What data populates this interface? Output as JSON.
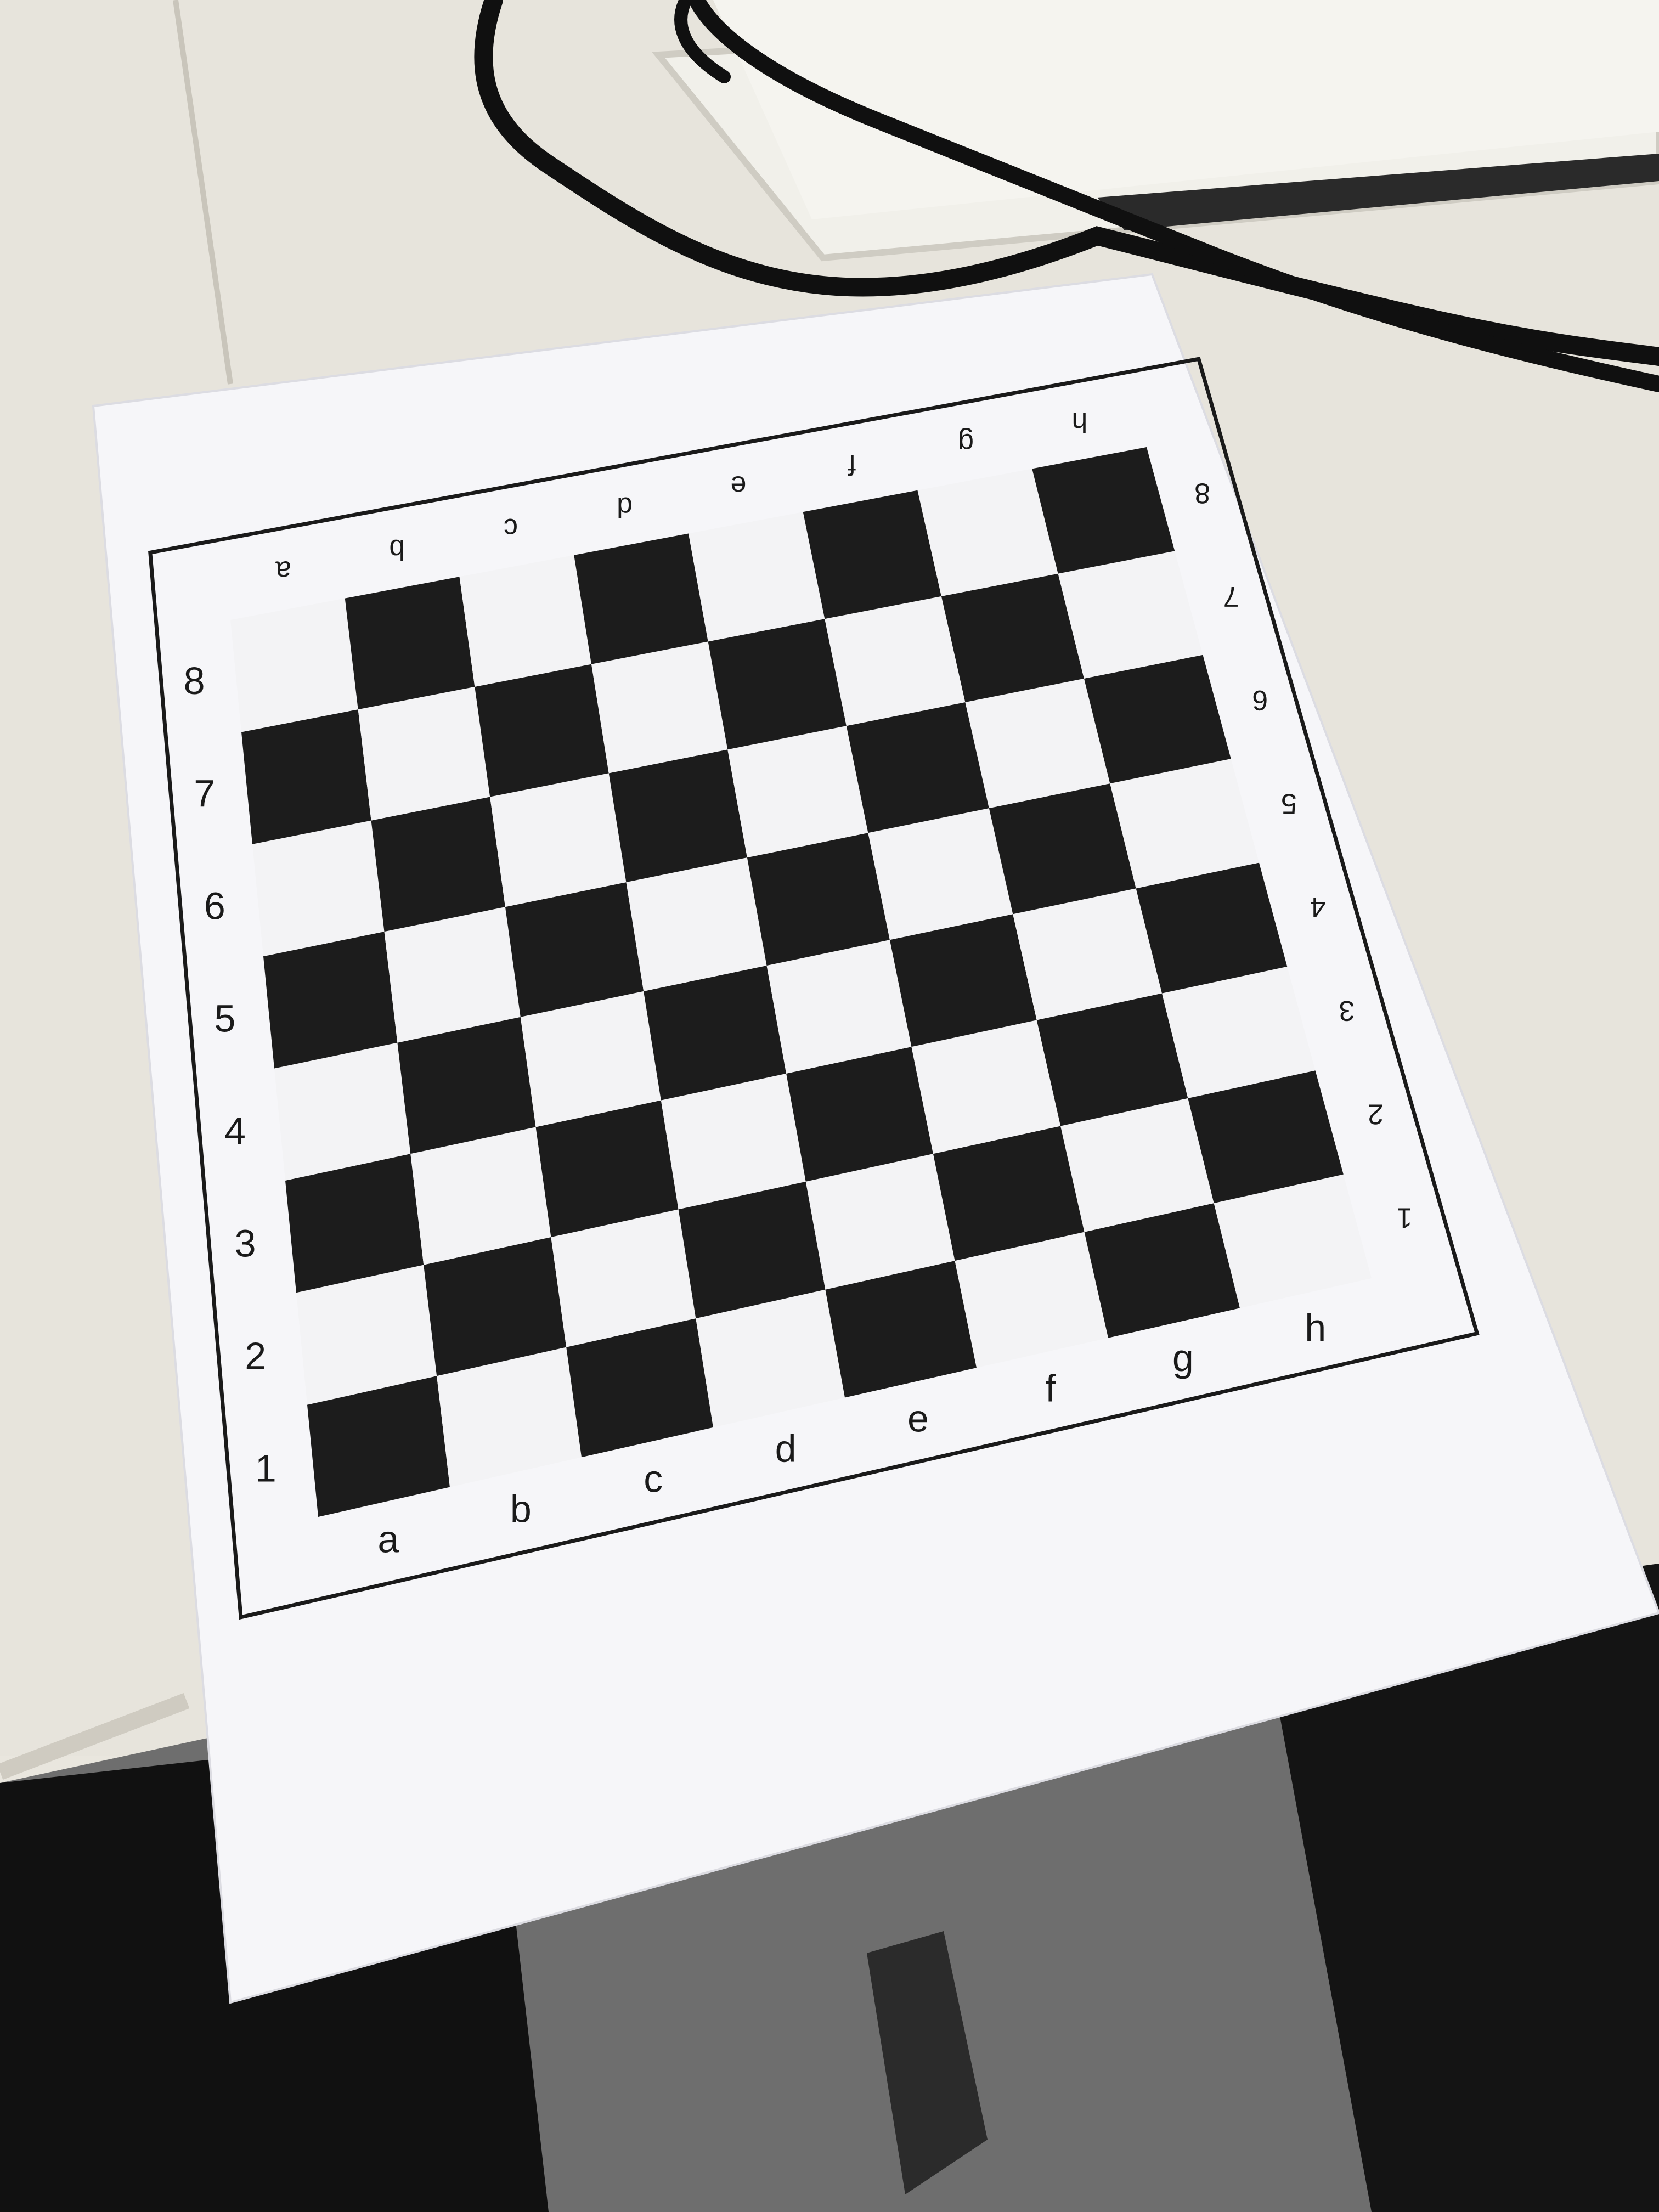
{
  "board": {
    "files": [
      "a",
      "b",
      "c",
      "d",
      "e",
      "f",
      "g",
      "h"
    ],
    "ranks": [
      "1",
      "2",
      "3",
      "4",
      "5",
      "6",
      "7",
      "8"
    ],
    "dark_square_color": "#1c1c1c",
    "light_square_color": "#f3f3f5"
  },
  "paper": {
    "color": "#f6f6f9"
  },
  "table": {
    "color": "#e7e4dc"
  },
  "floor": {
    "color": "#6e6e6e"
  },
  "cable": {
    "color": "#101010"
  }
}
